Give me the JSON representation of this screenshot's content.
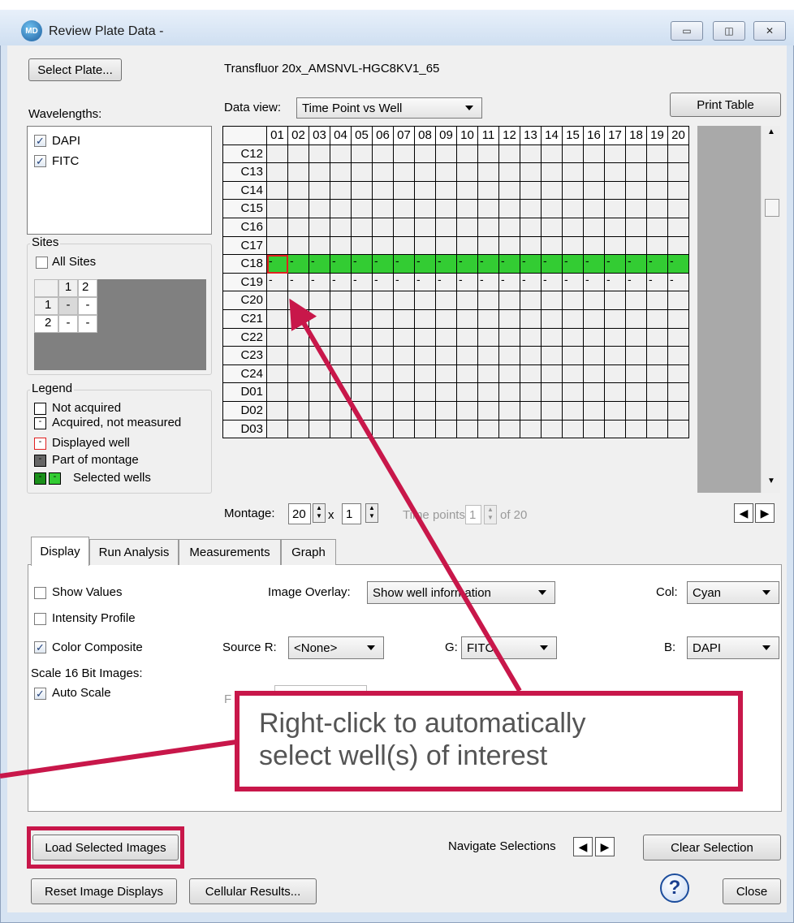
{
  "window": {
    "title": "Review Plate Data -",
    "min_glyph": "▭",
    "max_glyph": "◫",
    "close_glyph": "✕"
  },
  "plate": {
    "select_button": "Select Plate...",
    "name": "Transfluor 20x_AMSNVL-HGC8KV1_65"
  },
  "wavelengths": {
    "label": "Wavelengths:",
    "items": [
      {
        "label": "DAPI",
        "checked": true
      },
      {
        "label": "FITC",
        "checked": true
      }
    ]
  },
  "sites": {
    "label": "Sites",
    "all_sites": "All Sites",
    "col_headers": [
      "1",
      "2"
    ],
    "row_headers": [
      "1",
      "2"
    ],
    "cell": "-"
  },
  "legend": {
    "label": "Legend",
    "items": [
      "Not acquired",
      "Acquired, not measured",
      "Displayed well",
      "Part of montage",
      "Selected wells"
    ]
  },
  "data_view": {
    "label": "Data view:",
    "value": "Time Point vs Well",
    "print_button": "Print Table"
  },
  "grid": {
    "columns": [
      "01",
      "02",
      "03",
      "04",
      "05",
      "06",
      "07",
      "08",
      "09",
      "10",
      "11",
      "12",
      "13",
      "14",
      "15",
      "16",
      "17",
      "18",
      "19",
      "20"
    ],
    "rows": [
      "C12",
      "C13",
      "C14",
      "C15",
      "C16",
      "C17",
      "C18",
      "C19",
      "C20",
      "C21",
      "C22",
      "C23",
      "C24",
      "D01",
      "D02",
      "D03"
    ],
    "acquired_marker": "-",
    "selected_row": "C18",
    "acquired_row": "C19"
  },
  "montage": {
    "label": "Montage:",
    "x": "20",
    "times": "x",
    "y": "1",
    "time_points_label": "Time points:",
    "time_point_value": "1",
    "of_label": "of 20"
  },
  "tabs": [
    "Display",
    "Run Analysis",
    "Measurements",
    "Graph"
  ],
  "display": {
    "show_values": "Show Values",
    "intensity_profile": "Intensity Profile",
    "color_composite": "Color Composite",
    "scale_label": "Scale 16 Bit Images:",
    "auto_scale": "Auto Scale",
    "image_overlay_label": "Image Overlay:",
    "image_overlay_value": "Show well information",
    "col_label": "Col:",
    "col_value": "Cyan",
    "source_r_label": "Source R:",
    "source_r_value": "<None>",
    "g_label": "G:",
    "g_value": "FITC",
    "b_label": "B:",
    "b_value": "DAPI",
    "hidden_label": "F"
  },
  "callout": {
    "line1": "Right-click to automatically",
    "line2": "select well(s) of interest"
  },
  "bottom": {
    "load_selected": "Load Selected Images",
    "navigate_label": "Navigate Selections",
    "clear_selection": "Clear Selection",
    "reset_displays": "Reset Image Displays",
    "cellular_results": "Cellular Results...",
    "help_glyph": "?",
    "close": "Close"
  },
  "colors": {
    "accent": "#c8174a",
    "selected_green": "#33cc33",
    "displayed_red": "#e02020"
  }
}
